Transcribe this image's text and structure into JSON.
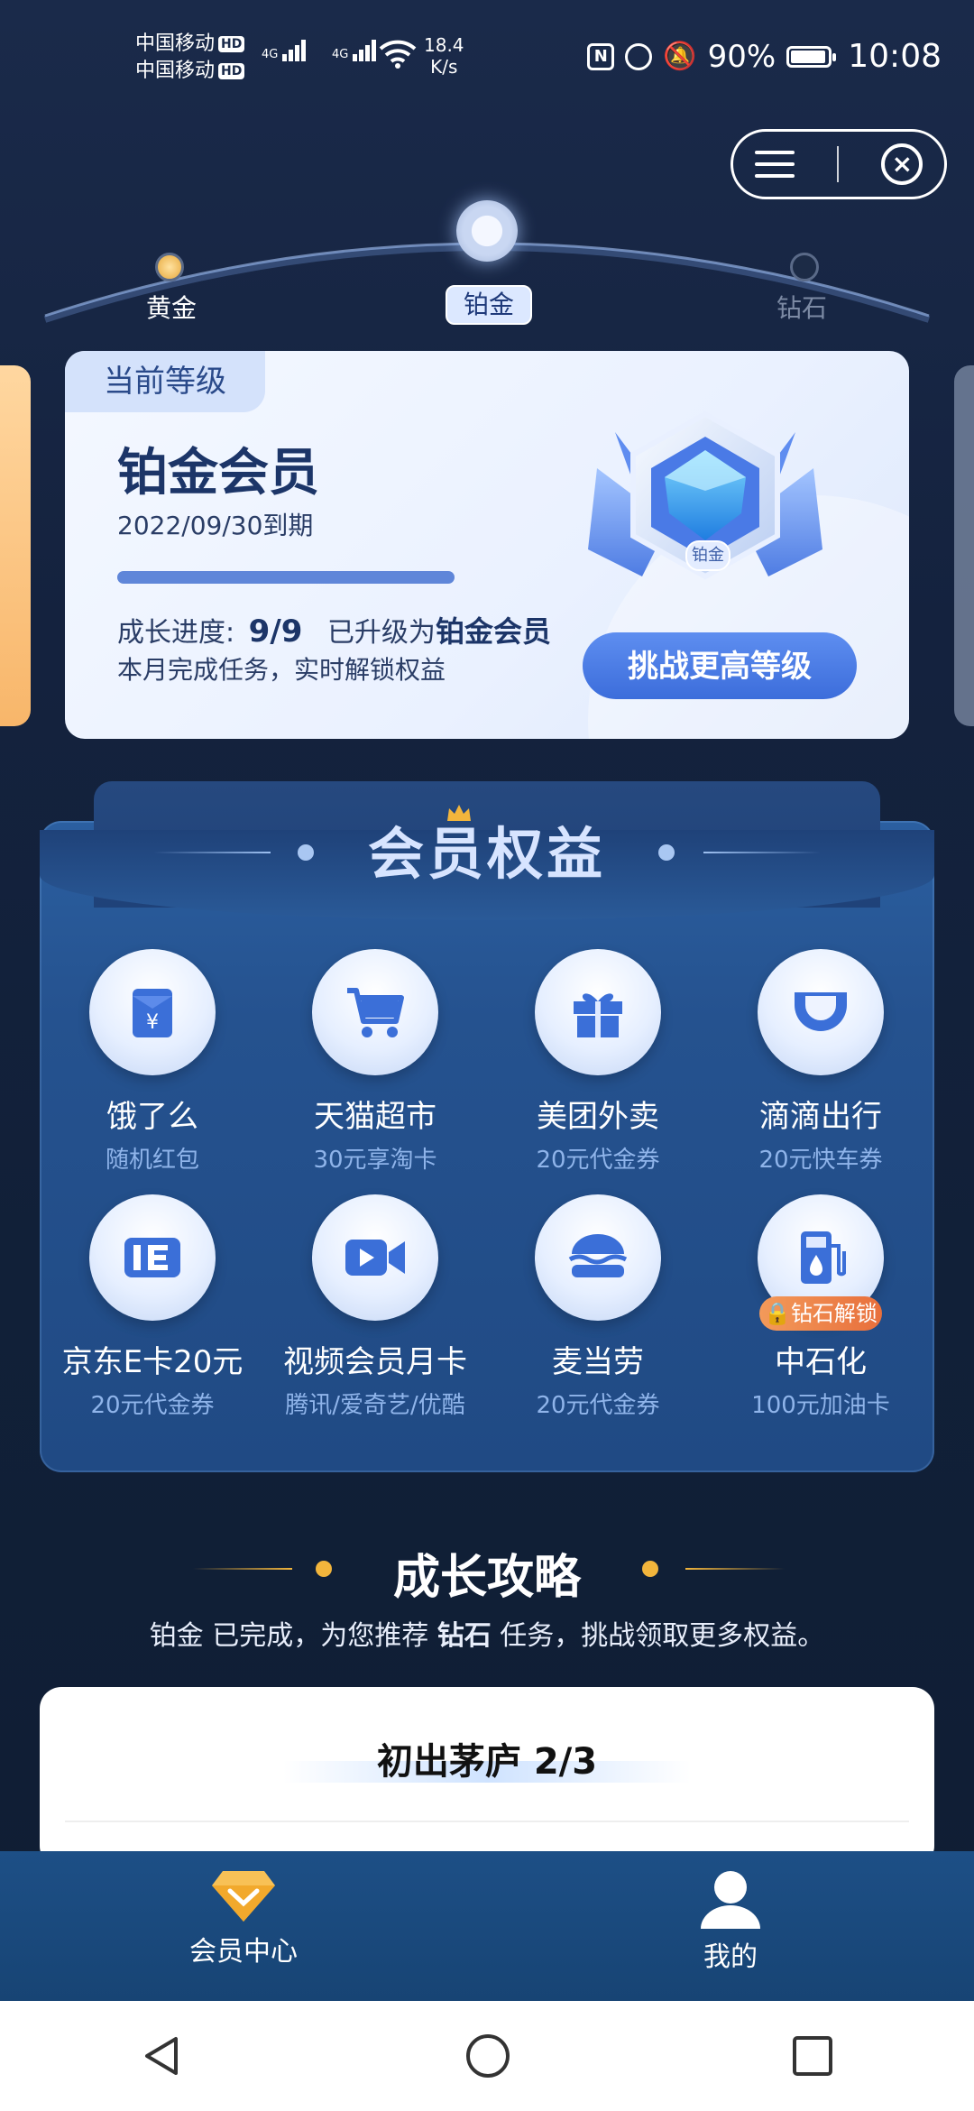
{
  "status_bar": {
    "carrier1": "中国移动",
    "carrier2": "中国移动",
    "hd": "HD",
    "net_type": "4G",
    "speed_value": "18.4",
    "speed_unit": "K/s",
    "battery": "90%",
    "time": "10:08"
  },
  "levels": {
    "items": [
      "黄金",
      "铂金",
      "钻石"
    ],
    "current": "铂金"
  },
  "card": {
    "tag": "当前等级",
    "title": "铂金会员",
    "expiry": "2022/09/30到期",
    "growth_label": "成长进度:",
    "growth_value": "9/9",
    "upgraded_prefix": "已升级为",
    "upgraded_level": "铂金会员",
    "monthly_note": "本月完成任务，实时解锁权益",
    "challenge_button": "挑战更高等级",
    "badge_label": "铂金",
    "progress_fraction": 1.0
  },
  "benefits": {
    "title": "会员权益",
    "items": [
      {
        "name": "饿了么",
        "desc": "随机红包",
        "icon": "red-envelope-icon"
      },
      {
        "name": "天猫超市",
        "desc": "30元享淘卡",
        "icon": "cart-icon"
      },
      {
        "name": "美团外卖",
        "desc": "20元代金券",
        "icon": "gift-icon"
      },
      {
        "name": "滴滴出行",
        "desc": "20元快车券",
        "icon": "didi-icon"
      },
      {
        "name": "京东E卡20元",
        "desc": "20元代金券",
        "icon": "ecard-icon"
      },
      {
        "name": "视频会员月卡",
        "desc": "腾讯/爱奇艺/优酷",
        "icon": "video-icon"
      },
      {
        "name": "麦当劳",
        "desc": "20元代金券",
        "icon": "burger-icon"
      },
      {
        "name": "中石化",
        "desc": "100元加油卡",
        "icon": "fuel-icon"
      }
    ],
    "lock_badge": "钻石解锁"
  },
  "growth_strategy": {
    "title": "成长攻略",
    "sub_prefix": "铂金 已完成，为您推荐 ",
    "sub_level": "钻石",
    "sub_suffix": " 任务，挑战领取更多权益。",
    "card_title": "初出茅庐 2/3"
  },
  "bottom_nav": {
    "items": [
      {
        "label": "会员中心",
        "icon": "diamond-icon"
      },
      {
        "label": "我的",
        "icon": "user-icon"
      }
    ]
  },
  "colors": {
    "accent": "#3c6ddb",
    "gold": "#f2b53c",
    "lock": "#e86f3c"
  }
}
